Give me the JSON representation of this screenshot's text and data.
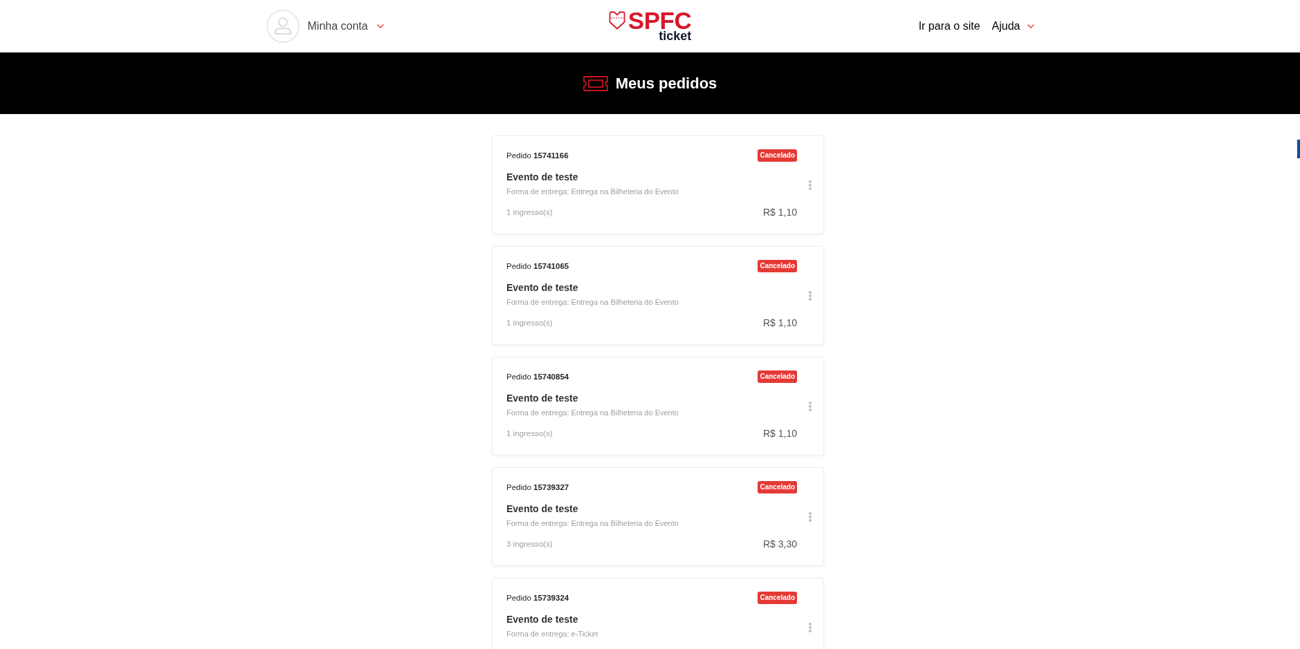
{
  "header": {
    "account": {
      "label": "Minha conta"
    },
    "logo": {
      "wordmark": "SPFC",
      "subtitle": "ticket"
    },
    "nav": [
      {
        "label": "Ir para o site",
        "kind": "link"
      },
      {
        "label": "Ajuda",
        "kind": "dropdown"
      }
    ]
  },
  "banner": {
    "title": "Meus pedidos"
  },
  "orders": [
    {
      "title": "Pedido **15741166**",
      "status": "Cancelado",
      "event": "Evento de teste",
      "delivery": "Forma de entrega: Entrega na Bilheteria do Evento",
      "tickets": "1 ingresso(s)",
      "total": "R$ 1,10"
    },
    {
      "title": "Pedido **15741065**",
      "status": "Cancelado",
      "event": "Evento de teste",
      "delivery": "Forma de entrega: Entrega na Bilheteria do Evento",
      "tickets": "1 ingresso(s)",
      "total": "R$ 1,10"
    },
    {
      "title": "Pedido **15740854**",
      "status": "Cancelado",
      "event": "Evento de teste",
      "delivery": "Forma de entrega: Entrega na Bilheteria do Evento",
      "tickets": "1 ingresso(s)",
      "total": "R$ 1,10"
    },
    {
      "title": "Pedido **15739327**",
      "status": "Cancelado",
      "event": "Evento de teste",
      "delivery": "Forma de entrega: Entrega na Bilheteria do Evento",
      "tickets": "3 ingresso(s)",
      "total": "R$ 3,30"
    },
    {
      "title": "Pedido **15739324**",
      "status": "Cancelado",
      "event": "Evento de teste",
      "delivery": "Forma de entrega: e-Ticket"
    }
  ]
}
